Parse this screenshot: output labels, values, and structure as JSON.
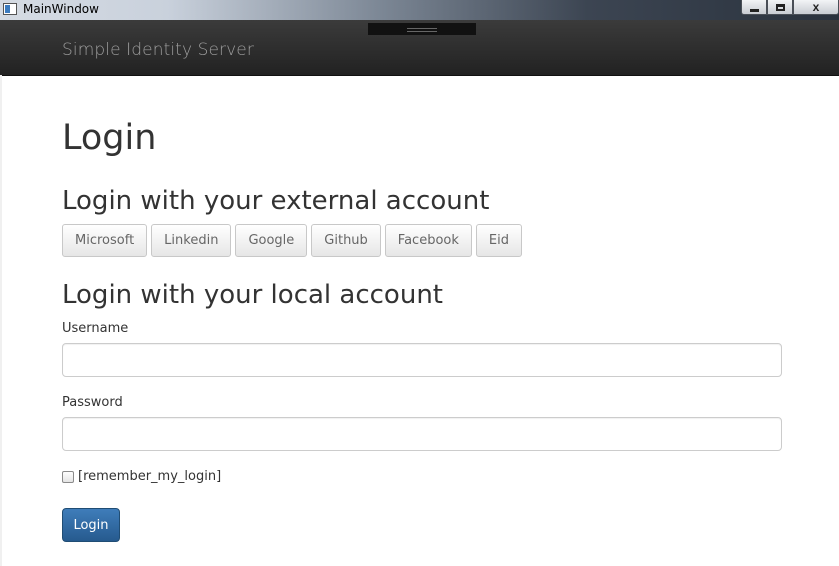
{
  "window": {
    "title": "MainWindow",
    "controls": {
      "minimize": "",
      "maximize": "",
      "close": "x"
    }
  },
  "navbar": {
    "brand": "Simple Identity Server"
  },
  "main": {
    "title": "Login",
    "external": {
      "heading": "Login with your external account",
      "providers": [
        "Microsoft",
        "Linkedin",
        "Google",
        "Github",
        "Facebook",
        "Eid"
      ]
    },
    "local": {
      "heading": "Login with your local account",
      "username_label": "Username",
      "username_value": "",
      "password_label": "Password",
      "password_value": "",
      "remember_label": "[remember_my_login]",
      "remember_checked": false,
      "login_button": "Login"
    }
  },
  "colors": {
    "navbar": "#222222",
    "brand_text": "#9d9d9d",
    "primary_button": "#337ab7"
  }
}
